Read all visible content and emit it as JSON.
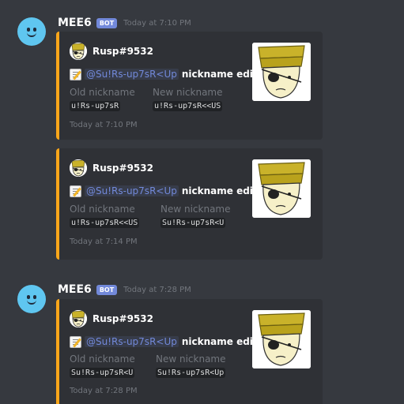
{
  "messages": [
    {
      "author": "MEE6",
      "bot_tag": "BOT",
      "timestamp": "Today at 7:10 PM",
      "embeds": [
        {
          "author": "Rusp#9532",
          "mention": "@Su!Rs-up7sR<Up",
          "action": "nickname edited",
          "old_label": "Old nickname",
          "old_value": "u!Rs-up7sR",
          "new_label": "New nickname",
          "new_value": "u!Rs-up7sR<<US",
          "footer": "Today at 7:10 PM"
        },
        {
          "author": "Rusp#9532",
          "mention": "@Su!Rs-up7sR<Up",
          "action": "nickname edited",
          "old_label": "Old nickname",
          "old_value": "u!Rs-up7sR<<US",
          "new_label": "New nickname",
          "new_value": "Su!Rs-up7sR<U",
          "footer": "Today at 7:14 PM"
        }
      ]
    },
    {
      "author": "MEE6",
      "bot_tag": "BOT",
      "timestamp": "Today at 7:28 PM",
      "embeds": [
        {
          "author": "Rusp#9532",
          "mention": "@Su!Rs-up7sR<Up",
          "action": "nickname edited",
          "old_label": "Old nickname",
          "old_value": "Su!Rs-up7sR<U",
          "new_label": "New nickname",
          "new_value": "Su!Rs-up7sR<Up",
          "footer": "Today at 7:28 PM"
        }
      ]
    }
  ],
  "colors": {
    "background": "#36393f",
    "embed_background": "#2f3136",
    "embed_accent": "#faa61a",
    "bot_tag": "#7289da",
    "mention": "#7289da",
    "avatar": "#5fc6f0"
  },
  "icons": {
    "bot_avatar": "mee6-smiley-avatar",
    "description_icon": "memo-icon",
    "author_avatar": "cartoon-face-with-eyepatch-and-yellow-hat",
    "thumbnail": "cartoon-face-with-eyepatch-and-yellow-hat"
  }
}
